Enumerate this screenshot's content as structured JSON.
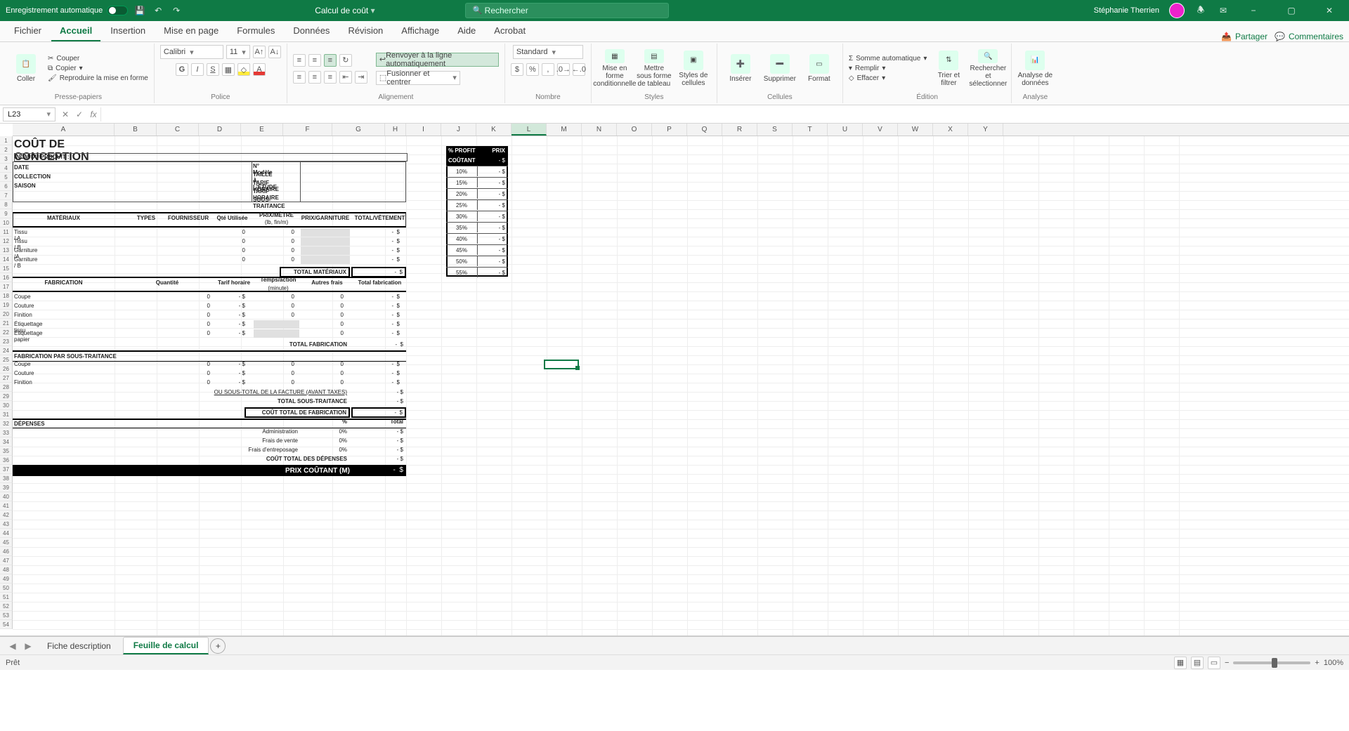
{
  "titlebar": {
    "autosave": "Enregistrement automatique",
    "docname": "Calcul de coût",
    "search_placeholder": "Rechercher",
    "user": "Stéphanie Therrien"
  },
  "tabs": {
    "items": [
      "Fichier",
      "Accueil",
      "Insertion",
      "Mise en page",
      "Formules",
      "Données",
      "Révision",
      "Affichage",
      "Aide",
      "Acrobat"
    ],
    "selected": 1,
    "share": "Partager",
    "comments": "Commentaires"
  },
  "ribbon": {
    "clipboard": {
      "paste": "Coller",
      "cut": "Couper",
      "copy": "Copier",
      "format": "Reproduire la mise en forme",
      "label": "Presse-papiers"
    },
    "font": {
      "name": "Calibri",
      "size": "11",
      "label": "Police"
    },
    "align": {
      "wrap": "Renvoyer à la ligne automatiquement",
      "merge": "Fusionner et centrer",
      "label": "Alignement"
    },
    "number": {
      "format": "Standard",
      "label": "Nombre"
    },
    "styles": {
      "cond": "Mise en forme conditionnelle",
      "table": "Mettre sous forme de tableau",
      "cell": "Styles de cellules",
      "label": "Styles"
    },
    "cells": {
      "insert": "Insérer",
      "delete": "Supprimer",
      "format": "Format",
      "label": "Cellules"
    },
    "edit": {
      "sum": "Somme automatique",
      "fill": "Remplir",
      "clear": "Effacer",
      "sort": "Trier et filtrer",
      "find": "Rechercher et sélectionner",
      "label": "Édition"
    },
    "analyze": {
      "btn": "Analyse de données",
      "label": "Analyse"
    }
  },
  "namebox": "L23",
  "columns": [
    "A",
    "B",
    "C",
    "D",
    "E",
    "F",
    "G",
    "H",
    "I",
    "J",
    "K",
    "L",
    "M",
    "N",
    "O",
    "P",
    "Q",
    "R",
    "S",
    "T",
    "U",
    "V",
    "W",
    "X",
    "Y"
  ],
  "selectedCol": "L",
  "doc": {
    "title": "COÛT DE CONCEPTION",
    "h_nom": "NOM DU PRODUIT :",
    "h_date": "DATE",
    "h_coll": "COLLECTION",
    "h_saison": "SAISON",
    "h_modele": "N° Modèle",
    "h_taille": "TAILLE À L'ÉTUDE",
    "h_tarif1": "TARIF HORAIRE",
    "h_tarif2": "TARIF HORAIRE",
    "h_sous": "SOUS-TRAITANCE",
    "mat": {
      "head": [
        "MATÉRIAUX",
        "TYPES",
        "FOURNISSEUR",
        "Qté Utilisée",
        "PRIX/MÈTRE",
        "PRIX/GARNITURE",
        "TOTAL/VÊTEMENT"
      ],
      "sub": "(lb, fin/m)",
      "rows": [
        "Tissu / A",
        "Tissu / B",
        "Garniture /A",
        "Garniture / B"
      ],
      "total": "TOTAL MATÉRIAUX"
    },
    "fab": {
      "head": [
        "FABRICATION",
        "Quantité",
        "Tarif horaire",
        "Temps/action",
        "Autres frais",
        "Total fabrication"
      ],
      "sub": "(minute)",
      "rows": [
        "Coupe",
        "Couture",
        "Finition",
        "Étiquettage tissu",
        "Étiquettage papier"
      ],
      "total": "TOTAL FABRICATION"
    },
    "sub": {
      "title": "FABRICATION PAR SOUS-TRAITANCE",
      "rows": [
        "Coupe",
        "Couture",
        "Finition"
      ],
      "line1": "OU SOUS-TOTAL DE LA FACTURE (AVANT TAXES)",
      "line2": "TOTAL SOUS-TRAITANCE",
      "line3": "COÛT TOTAL DE FABRICATION"
    },
    "dep": {
      "title": "DÉPENSES",
      "pct": "%",
      "tot": "Total",
      "rows": [
        "Administration",
        "Frais de vente",
        "Frais d'entreposage"
      ],
      "zero": "0%",
      "total": "COÛT TOTAL DES DÉPENSES"
    },
    "final": "PRIX COÛTANT (M)",
    "dollar": "$",
    "dash": "-",
    "side": {
      "h1": "% PROFIT",
      "h2": "PRIX",
      "cout": "COÛTANT",
      "rows": [
        "10%",
        "15%",
        "20%",
        "25%",
        "30%",
        "35%",
        "40%",
        "45%",
        "50%",
        "55%"
      ]
    }
  },
  "sheets": {
    "tab1": "Fiche description",
    "tab2": "Feuille de calcul"
  },
  "status": {
    "ready": "Prêt",
    "zoom": "100%"
  }
}
